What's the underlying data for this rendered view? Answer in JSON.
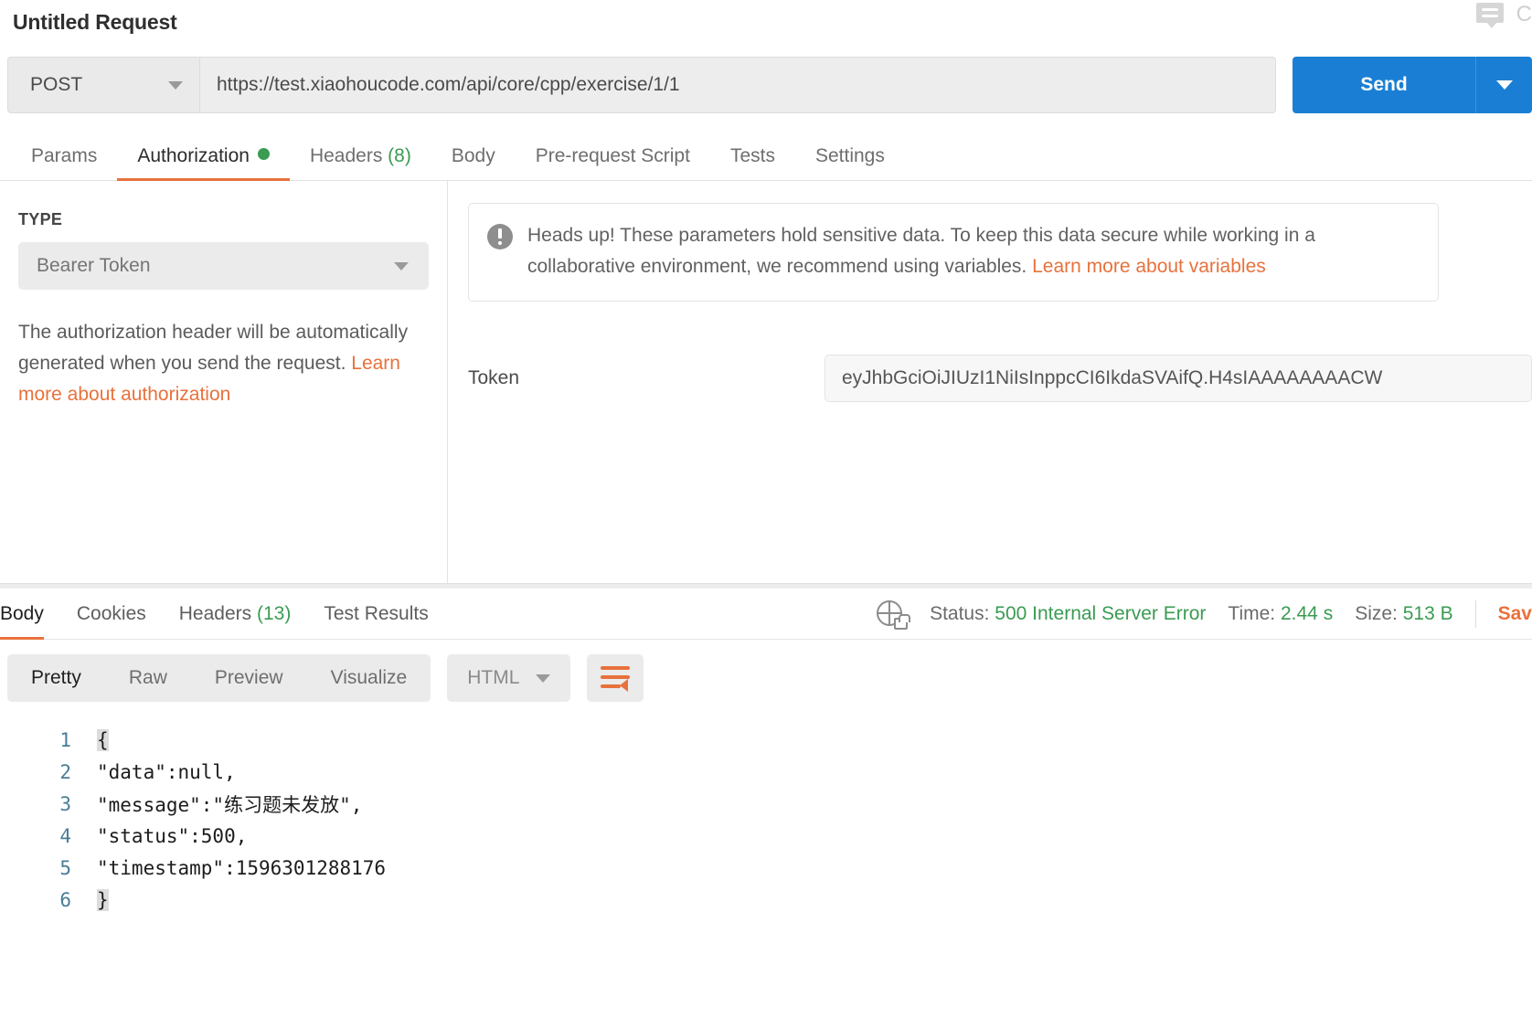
{
  "header": {
    "request_title": "Untitled Request",
    "comment_icon": "comment-icon",
    "trailing_letter": "C"
  },
  "url_bar": {
    "method": "POST",
    "method_caret": "chevron-down-icon",
    "url": "https://test.xiaohoucode.com/api/core/cpp/exercise/1/1",
    "send_label": "Send",
    "send_caret": "chevron-down-icon",
    "send_color": "#1a7fd4"
  },
  "request_tabs": [
    {
      "label": "Params",
      "active": false,
      "count": "",
      "dot": false
    },
    {
      "label": "Authorization",
      "active": true,
      "count": "",
      "dot": true
    },
    {
      "label": "Headers",
      "active": false,
      "count": "(8)",
      "dot": false
    },
    {
      "label": "Body",
      "active": false,
      "count": "",
      "dot": false
    },
    {
      "label": "Pre-request Script",
      "active": false,
      "count": "",
      "dot": false
    },
    {
      "label": "Tests",
      "active": false,
      "count": "",
      "dot": false
    },
    {
      "label": "Settings",
      "active": false,
      "count": "",
      "dot": false
    }
  ],
  "authorization": {
    "type_label": "TYPE",
    "type_value": "Bearer Token",
    "type_caret": "chevron-down-icon",
    "description_part1": "The authorization header will be automatically generated when you send the request. ",
    "description_link": "Learn more about authorization",
    "notice_icon": "info-icon",
    "notice_text": "Heads up! These parameters hold sensitive data. To keep this data secure while working in a collaborative environment, we recommend using variables. ",
    "notice_link": "Learn more about variables",
    "token_label": "Token",
    "token_value": "eyJhbGciOiJIUzI1NiIsInppcCI6IkdaSVAifQ.H4sIAAAAAAAACW"
  },
  "response_tabs": [
    {
      "label": "Body",
      "active": true,
      "count": ""
    },
    {
      "label": "Cookies",
      "active": false,
      "count": ""
    },
    {
      "label": "Headers",
      "active": false,
      "count": "(13)"
    },
    {
      "label": "Test Results",
      "active": false,
      "count": ""
    }
  ],
  "response_status": {
    "security_icon": "globe-lock-icon",
    "status_label": "Status:",
    "status_value": "500 Internal Server Error",
    "time_label": "Time:",
    "time_value": "2.44 s",
    "size_label": "Size:",
    "size_value": "513 B",
    "save_label": "Sav",
    "value_color": "#3a9b52"
  },
  "viewer_toolbar": {
    "modes": [
      {
        "label": "Pretty",
        "active": true
      },
      {
        "label": "Raw",
        "active": false
      },
      {
        "label": "Preview",
        "active": false
      },
      {
        "label": "Visualize",
        "active": false
      }
    ],
    "format": "HTML",
    "format_caret": "chevron-down-icon",
    "wrap_icon": "word-wrap-icon",
    "wrap_color": "#e8713c"
  },
  "response_body": {
    "lines": [
      {
        "n": "1",
        "text": "{",
        "highlight": true
      },
      {
        "n": "2",
        "text": "\"data\":null,",
        "highlight": false
      },
      {
        "n": "3",
        "text": "\"message\":\"练习题未发放\",",
        "highlight": false
      },
      {
        "n": "4",
        "text": "\"status\":500,",
        "highlight": false
      },
      {
        "n": "5",
        "text": "\"timestamp\":1596301288176",
        "highlight": false
      },
      {
        "n": "6",
        "text": "}",
        "highlight": true
      }
    ]
  }
}
